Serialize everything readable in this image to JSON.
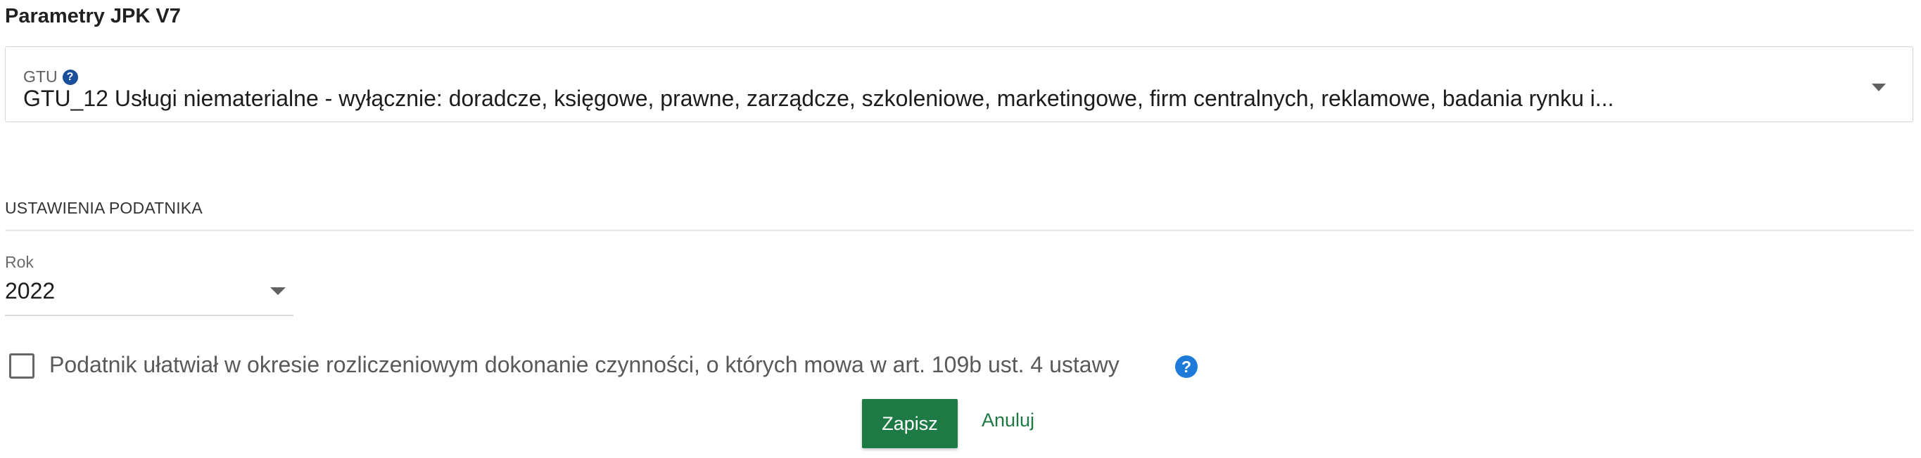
{
  "section_title": "Parametry JPK V7",
  "gtu": {
    "label": "GTU",
    "help": "?",
    "value": "GTU_12 Usługi niematerialne - wyłącznie: doradcze, księgowe, prawne, zarządcze, szkoleniowe, marketingowe, firm centralnych, reklamowe, badania rynku i..."
  },
  "taxpayer_section": {
    "heading": "USTAWIENIA PODATNIKA",
    "year": {
      "label": "Rok",
      "value": "2022"
    },
    "checkbox": {
      "checked": false,
      "label": "Podatnik ułatwiał w okresie rozliczeniowym dokonanie czynności, o których mowa w art. 109b ust. 4 ustawy",
      "help": "?"
    }
  },
  "actions": {
    "save": "Zapisz",
    "cancel": "Anuluj"
  },
  "colors": {
    "primary": "#1e7a45",
    "help_dark": "#1a4f9c",
    "help_blue": "#1e7bd9"
  },
  "icons": {
    "gtu_dropdown": "chevron-down-icon",
    "year_dropdown": "chevron-down-icon",
    "help": "help-circle-icon"
  }
}
